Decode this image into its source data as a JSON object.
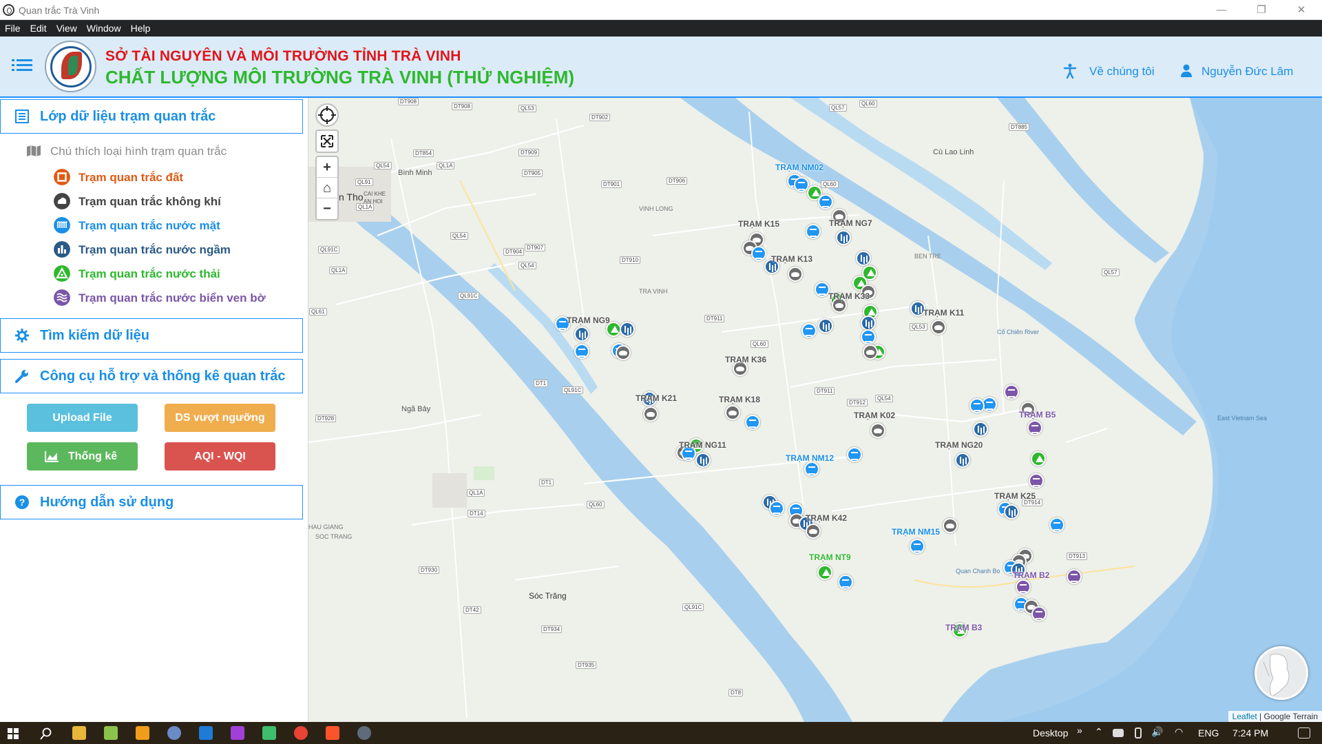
{
  "window": {
    "title": "Quan trắc Trà Vinh",
    "minimize": "—",
    "maximize": "❐",
    "close": "✕"
  },
  "menu": [
    "File",
    "Edit",
    "View",
    "Window",
    "Help"
  ],
  "header": {
    "org_name": "SỞ TÀI NGUYÊN VÀ MÔI TRƯỜNG TỈNH TRÀ VINH",
    "app_title": "CHẤT LƯỢNG MÔI TRƯỜNG TRÀ VINH (THỬ NGHIỆM)",
    "about_label": "Về chúng tôi",
    "user_name": "Nguyễn Đức Lâm"
  },
  "sidebar": {
    "layers_title": "Lớp dữ liệu trạm quan trắc",
    "legend_title": "Chú thích loại hình trạm quan trắc",
    "legend": [
      {
        "label": "Trạm quan trắc đất",
        "color": "#e05a14",
        "icon": "soil-station-icon"
      },
      {
        "label": "Trạm quan trắc không khí",
        "color": "#444444",
        "icon": "air-station-icon"
      },
      {
        "label": "Trạm quan trắc nước mặt",
        "color": "#1a8fe6",
        "icon": "surface-water-station-icon"
      },
      {
        "label": "Trạm quan trắc nước ngầm",
        "color": "#2b5a86",
        "icon": "groundwater-station-icon"
      },
      {
        "label": "Trạm quan trắc nước thải",
        "color": "#2eb82e",
        "icon": "wastewater-station-icon"
      },
      {
        "label": "Trạm quan trắc nước biển ven bờ",
        "color": "#7b56a8",
        "icon": "coastal-seawater-station-icon"
      }
    ],
    "search_title": "Tìm kiếm dữ liệu",
    "tools_title": "Công cụ hỗ trợ và thống kê quan trắc",
    "buttons": {
      "upload": "Upload File",
      "exceed": "DS vượt ngưỡng",
      "stats": "Thống kê",
      "aqi": "AQI - WQI"
    },
    "guide_title": "Hướng dẫn sử dụng"
  },
  "map": {
    "attribution_leaflet": "Leaflet",
    "attribution_sep": " | ",
    "attribution_terrain": "Google Terrain",
    "zoom_in": "+",
    "zoom_out": "−",
    "home": "⌂",
    "places": [
      "Bình Minh",
      "n Tho",
      "Cù Lao Linh",
      "Ngã Bảy",
      "Sóc Trăng",
      "VINH LONG",
      "TRA VINH",
      "CAI KHE",
      "AN HOI",
      "HAU GIANG",
      "SOC TRANG",
      "BEN TRE",
      "Cổ Chiên River",
      "East Vietnam Sea",
      "Quan Chanh Bo"
    ],
    "stations": [
      {
        "label": "TRẠM NM02",
        "type": "water"
      },
      {
        "label": "TRẠM K15",
        "type": "air"
      },
      {
        "label": "TRẠM NG7",
        "type": "ground"
      },
      {
        "label": "TRẠM K13",
        "type": "air"
      },
      {
        "label": "TRẠM K33",
        "type": "air"
      },
      {
        "label": "TRẠM K11",
        "type": "air"
      },
      {
        "label": "TRẠM NG9",
        "type": "ground"
      },
      {
        "label": "TRẠM K36",
        "type": "air"
      },
      {
        "label": "TRẠM K21",
        "type": "air"
      },
      {
        "label": "TRẠM K18",
        "type": "air"
      },
      {
        "label": "TRẠM K02",
        "type": "air"
      },
      {
        "label": "TRẠM B5",
        "type": "sea"
      },
      {
        "label": "TRẠM NG11",
        "type": "ground"
      },
      {
        "label": "TRẠM NM12",
        "type": "water"
      },
      {
        "label": "TRẠM NG20",
        "type": "ground"
      },
      {
        "label": "TRẠM K25",
        "type": "air"
      },
      {
        "label": "TRẠM K42",
        "type": "air"
      },
      {
        "label": "TRẠM NM15",
        "type": "water"
      },
      {
        "label": "TRẠM NT9",
        "type": "waste"
      },
      {
        "label": "TRẠM B2",
        "type": "sea"
      },
      {
        "label": "TRẠM B3",
        "type": "sea"
      }
    ],
    "roads": [
      "DT908",
      "DT908",
      "QL53",
      "QL57",
      "QL60",
      "DT854",
      "QL54",
      "QL1A",
      "DT909",
      "QL91",
      "DT905",
      "DT901",
      "DT906",
      "QL1A",
      "QL54",
      "QL91C",
      "QL1A",
      "DT904",
      "DT907",
      "QL54",
      "QL61",
      "DT911",
      "DT910",
      "QL91C",
      "QL60",
      "DT1",
      "QL91C",
      "DT911",
      "DT912",
      "QL54",
      "DT928",
      "QL1A",
      "DT1",
      "DT14",
      "QL60",
      "DT930",
      "DT42",
      "DT934",
      "DT935",
      "DT8",
      "QL91C",
      "DT913",
      "DT914",
      "DT885",
      "QL57",
      "QL53",
      "QL60",
      "DT902"
    ]
  },
  "taskbar": {
    "desktop_label": "Desktop",
    "lang": "ENG",
    "time": "7:24 PM"
  }
}
